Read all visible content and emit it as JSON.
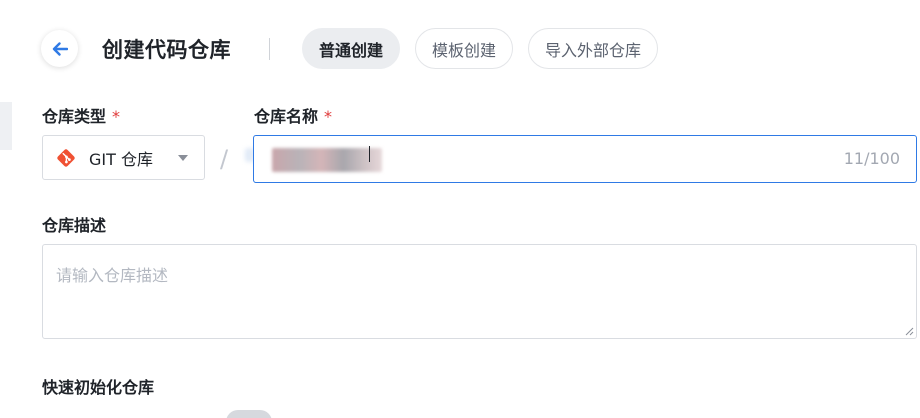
{
  "header": {
    "title": "创建代码仓库",
    "back_icon": "arrow-left-icon"
  },
  "mode_tabs": [
    {
      "label": "普通创建",
      "active": true
    },
    {
      "label": "模板创建",
      "active": false
    },
    {
      "label": "导入外部仓库",
      "active": false
    }
  ],
  "form": {
    "repo_type": {
      "label": "仓库类型",
      "required_mark": "*",
      "value": "GIT 仓库",
      "icon": "git-icon"
    },
    "path_separator": "/",
    "repo_name": {
      "label": "仓库名称",
      "required_mark": "*",
      "value": "",
      "count": "11/100"
    },
    "description": {
      "label": "仓库描述",
      "placeholder": "请输入仓库描述"
    },
    "quick_init": {
      "label": "快速初始化仓库"
    }
  },
  "colors": {
    "accent": "#2f7ae5",
    "required": "#e03a3a",
    "git_brand": "#f05133"
  }
}
